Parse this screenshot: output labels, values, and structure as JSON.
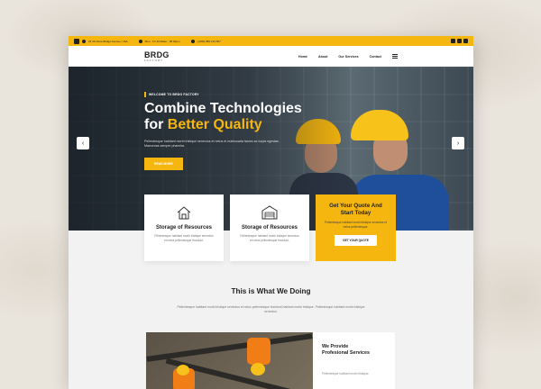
{
  "topbar": {
    "address": "23 40 Clare Bridge Avenue, USA",
    "hours": "Mon - Fri 10.00am - 05.00pm",
    "phone": "(+800) 883 123 567"
  },
  "nav": {
    "logo_main": "BRDG",
    "logo_sub": "FACTORY",
    "items": [
      "Home",
      "About",
      "Our Services",
      "Contact"
    ]
  },
  "hero": {
    "badge": "WELCOME TO BRDG FACTORY",
    "title_line1": "Combine Technologies",
    "title_prefix": "for",
    "title_highlight": "Better Quality",
    "description": "Pellentesque habitant morbi tristique senectus et netus et malesuada fames ac turpis egestas. Maecenas semper pharetra.",
    "button": "READ MORE"
  },
  "cards": [
    {
      "title": "Storage of Resources",
      "text": "Pellentesque habitant morbi tristique senectus et netus pellentesque tincidunt.",
      "icon": "house-tools-icon"
    },
    {
      "title": "Storage of Resources",
      "text": "Pellentesque habitant morbi tristique senectus et netus pellentesque tincidunt.",
      "icon": "warehouse-icon"
    }
  ],
  "quote": {
    "title_line1": "Get Your Quote And",
    "title_line2": "Start Today",
    "text": "Pellentesque habitant morbi tristique senectus et netus pellentesque.",
    "button": "GET YOUR QUOTE"
  },
  "section": {
    "title": "This is What We Doing",
    "description": "Pellentesque habitant morbi tristique senectus et netus pellentesque tincidunt habitant morbi tristique. Pellentesque habitant morbi tristique senectus."
  },
  "service": {
    "title_line1": "We Provide",
    "title_line2": "Profesional Services",
    "text": "Pellentesque habitant morbi tristique."
  },
  "colors": {
    "accent": "#f5b60f",
    "dark": "#222222"
  }
}
